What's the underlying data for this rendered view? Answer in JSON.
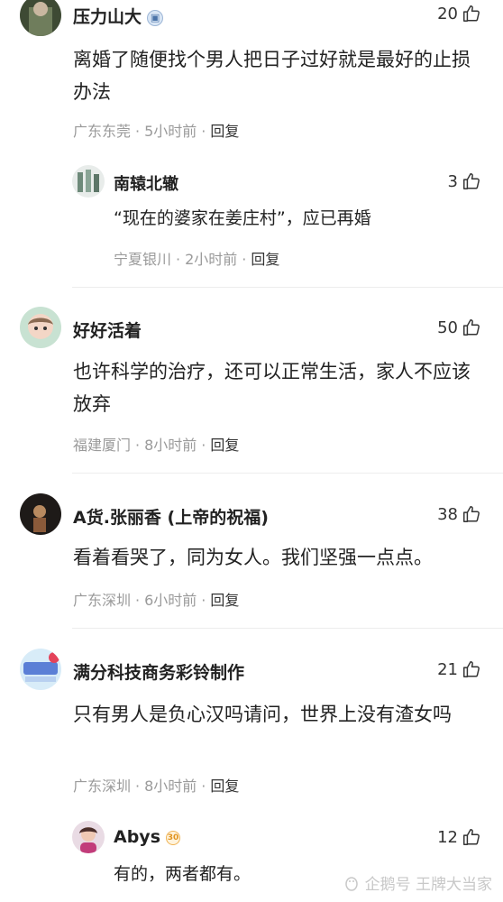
{
  "comments": [
    {
      "author": "压力山大",
      "badge": "blue",
      "likes": "20",
      "text": "离婚了随便找个男人把日子过好就是最好的止损办法",
      "location": "广东东莞",
      "time": "5小时前",
      "reply_label": "回复",
      "replies": [
        {
          "author": "南辕北辙",
          "likes": "3",
          "text": "“现在的婆家在姜庄村”，应已再婚",
          "location": "宁夏银川",
          "time": "2小时前",
          "reply_label": "回复"
        }
      ]
    },
    {
      "author": "好好活着",
      "likes": "50",
      "text": "也许科学的治疗，还可以正常生活，家人不应该放弃",
      "location": "福建厦门",
      "time": "8小时前",
      "reply_label": "回复"
    },
    {
      "author": "A货.张丽香 (上帝的祝福)",
      "likes": "38",
      "text": "看着看哭了，同为女人。我们坚强一点点。",
      "location": "广东深圳",
      "time": "6小时前",
      "reply_label": "回复"
    },
    {
      "author": "满分科技商务彩铃制作",
      "likes": "21",
      "text": "只有男人是负心汉吗请问，世界上没有渣女吗",
      "location": "广东深圳",
      "time": "8小时前",
      "reply_label": "回复",
      "replies": [
        {
          "author": "Abys",
          "badge": "gold",
          "badge_text": "30",
          "likes": "12",
          "text": "有的，两者都有。"
        }
      ]
    }
  ],
  "watermark": {
    "text": "企鹅号 王牌大当家"
  },
  "separator": "·"
}
